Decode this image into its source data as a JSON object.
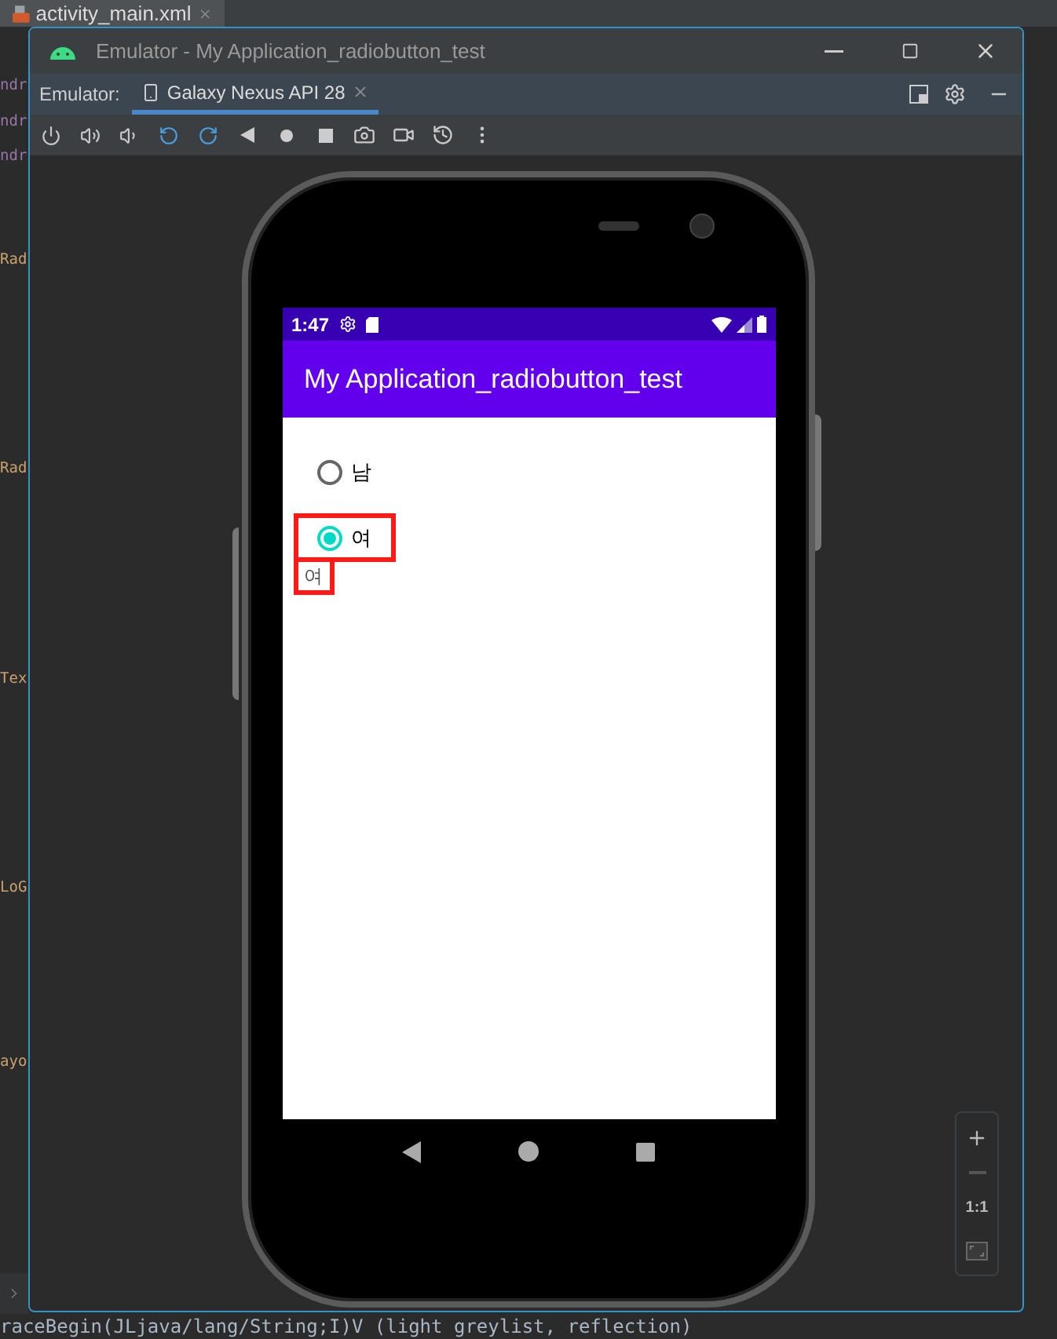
{
  "ide": {
    "file_tab": "activity_main.xml",
    "code_fragments": [
      {
        "text": "ndr",
        "kind": "attribute"
      },
      {
        "text": "ndr",
        "kind": "attribute"
      },
      {
        "text": "ndr",
        "kind": "attribute"
      },
      {
        "text": "Rad",
        "kind": "tag"
      },
      {
        "text": "Rad",
        "kind": "tag"
      },
      {
        "text": "Tex",
        "kind": "tag"
      },
      {
        "text": "LoG",
        "kind": "tag"
      },
      {
        "text": "ayo",
        "kind": "tag"
      }
    ],
    "log_line": "raceBegin(JLjava/lang/String;I)V (light greylist, reflection)"
  },
  "window": {
    "title": "Emulator - My Application_radiobutton_test"
  },
  "device_tabs": {
    "label": "Emulator:",
    "tabs": [
      {
        "label": "Galaxy Nexus API 28",
        "selected": true
      }
    ]
  },
  "phone": {
    "status_time": "1:47",
    "app_title": "My Application_radiobutton_test",
    "radio_buttons": [
      {
        "label": "남",
        "selected": false,
        "highlighted": false
      },
      {
        "label": "여",
        "selected": true,
        "highlighted": true
      }
    ],
    "result": {
      "text": "여",
      "highlighted": true
    }
  },
  "zoom": {
    "actual_size": "1:1",
    "zoom_out_disabled": true
  }
}
